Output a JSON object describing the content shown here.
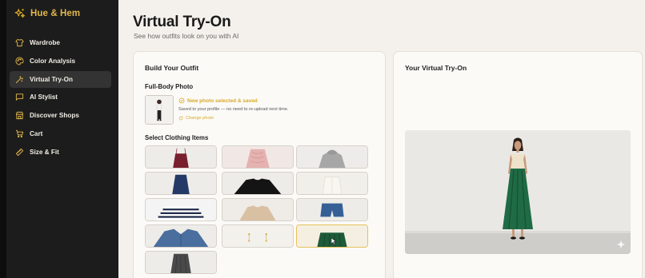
{
  "app": {
    "brand": "Hue & Hem"
  },
  "sidebar": {
    "items": [
      {
        "label": "Wardrobe",
        "icon": "shirt-icon",
        "active": false
      },
      {
        "label": "Color Analysis",
        "icon": "palette-icon",
        "active": false
      },
      {
        "label": "Virtual Try-On",
        "icon": "magic-wand-icon",
        "active": true
      },
      {
        "label": "AI Stylist",
        "icon": "chat-bubble-icon",
        "active": false
      },
      {
        "label": "Discover Shops",
        "icon": "store-icon",
        "active": false
      },
      {
        "label": "Cart",
        "icon": "cart-icon",
        "active": false
      },
      {
        "label": "Size & Fit",
        "icon": "ruler-icon",
        "active": false
      }
    ]
  },
  "header": {
    "title": "Virtual Try-On",
    "subtitle": "See how outfits look on you with AI"
  },
  "build": {
    "title": "Build Your Outfit",
    "photo_label": "Full-Body Photo",
    "photo_status": "New photo selected & saved",
    "photo_note": "Saved to your profile — no need to re-upload next time.",
    "change_photo": "Change photo",
    "items_label": "Select Clothing Items",
    "items": [
      {
        "name": "burgundy-camisole",
        "selected": false
      },
      {
        "name": "pink-ruffle-blouse",
        "selected": false
      },
      {
        "name": "grey-hoodie",
        "selected": false
      },
      {
        "name": "navy-skirt",
        "selected": false
      },
      {
        "name": "black-sweater",
        "selected": false
      },
      {
        "name": "cream-blouse",
        "selected": false
      },
      {
        "name": "striped-breton-top",
        "selected": false
      },
      {
        "name": "beige-knit-top",
        "selected": false
      },
      {
        "name": "denim-shorts",
        "selected": false
      },
      {
        "name": "denim-jacket",
        "selected": false
      },
      {
        "name": "gold-earrings",
        "selected": false
      },
      {
        "name": "green-pleated-skirt",
        "selected": true
      },
      {
        "name": "grey-pleated-skirt",
        "selected": false
      }
    ]
  },
  "tryon": {
    "title": "Your Virtual Try-On"
  },
  "colors": {
    "accent": "#d9a927",
    "sidebar_bg": "#1c1c1c",
    "active_item_bg": "#333333"
  }
}
